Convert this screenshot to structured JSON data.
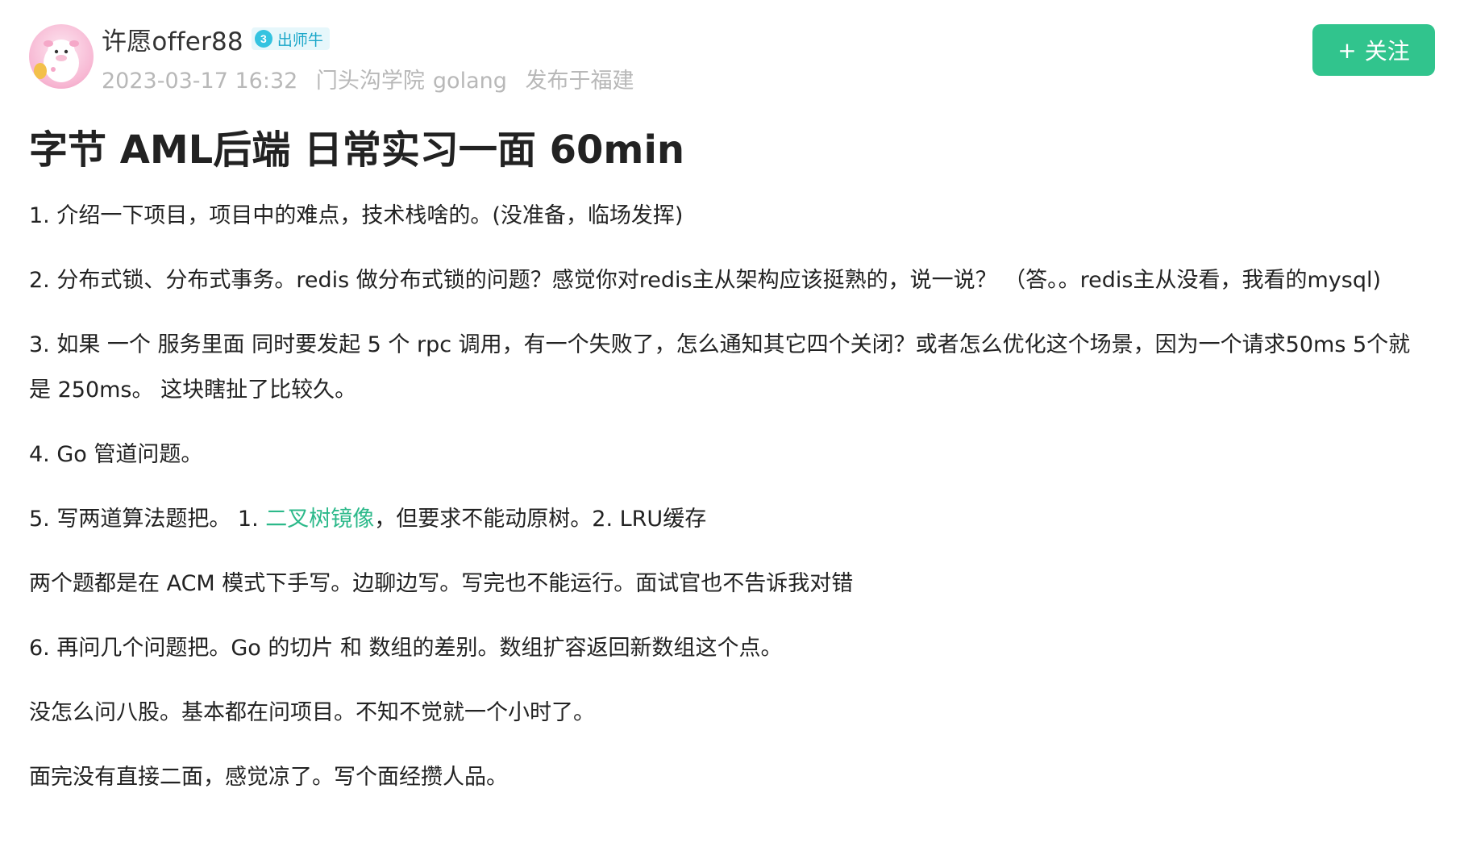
{
  "author": {
    "name": "许愿offer88",
    "level": "3",
    "badge_label": "出师牛"
  },
  "meta": {
    "datetime": "2023-03-17 16:32",
    "school": "门头沟学院",
    "tag": "golang",
    "location": "发布于福建"
  },
  "follow_button": {
    "plus": "+",
    "label": "关注"
  },
  "post": {
    "title": "字节 AML后端 日常实习一面 60min",
    "p1": "1. 介绍一下项目，项目中的难点，技术栈啥的。(没准备，临场发挥)",
    "p2": "2. 分布式锁、分布式事务。redis 做分布式锁的问题？感觉你对redis主从架构应该挺熟的，说一说？ （答。。redis主从没看，我看的mysql)",
    "p3": "3. 如果 一个 服务里面 同时要发起 5 个 rpc 调用，有一个失败了，怎么通知其它四个关闭？或者怎么优化这个场景，因为一个请求50ms 5个就是 250ms。 这块瞎扯了比较久。",
    "p4": "4. Go 管道问题。",
    "p5_prefix": "5. 写两道算法题把。 1. ",
    "p5_link": "二叉树镜像",
    "p5_suffix": "，但要求不能动原树。2. LRU缓存",
    "p6": "两个题都是在 ACM 模式下手写。边聊边写。写完也不能运行。面试官也不告诉我对错",
    "p7": "6. 再问几个问题把。Go 的切片 和 数组的差别。数组扩容返回新数组这个点。",
    "p8": "没怎么问八股。基本都在问项目。不知不觉就一个小时了。",
    "p9": "面完没有直接二面，感觉凉了。写个面经攒人品。"
  },
  "colors": {
    "accent_green": "#31c48d",
    "link_green": "#2cb98a",
    "badge_blue": "#34c3e0",
    "meta_gray": "#b8b8b8"
  },
  "icons": {
    "avatar": "cartoon-cow-avatar",
    "level": "level-badge-icon"
  }
}
